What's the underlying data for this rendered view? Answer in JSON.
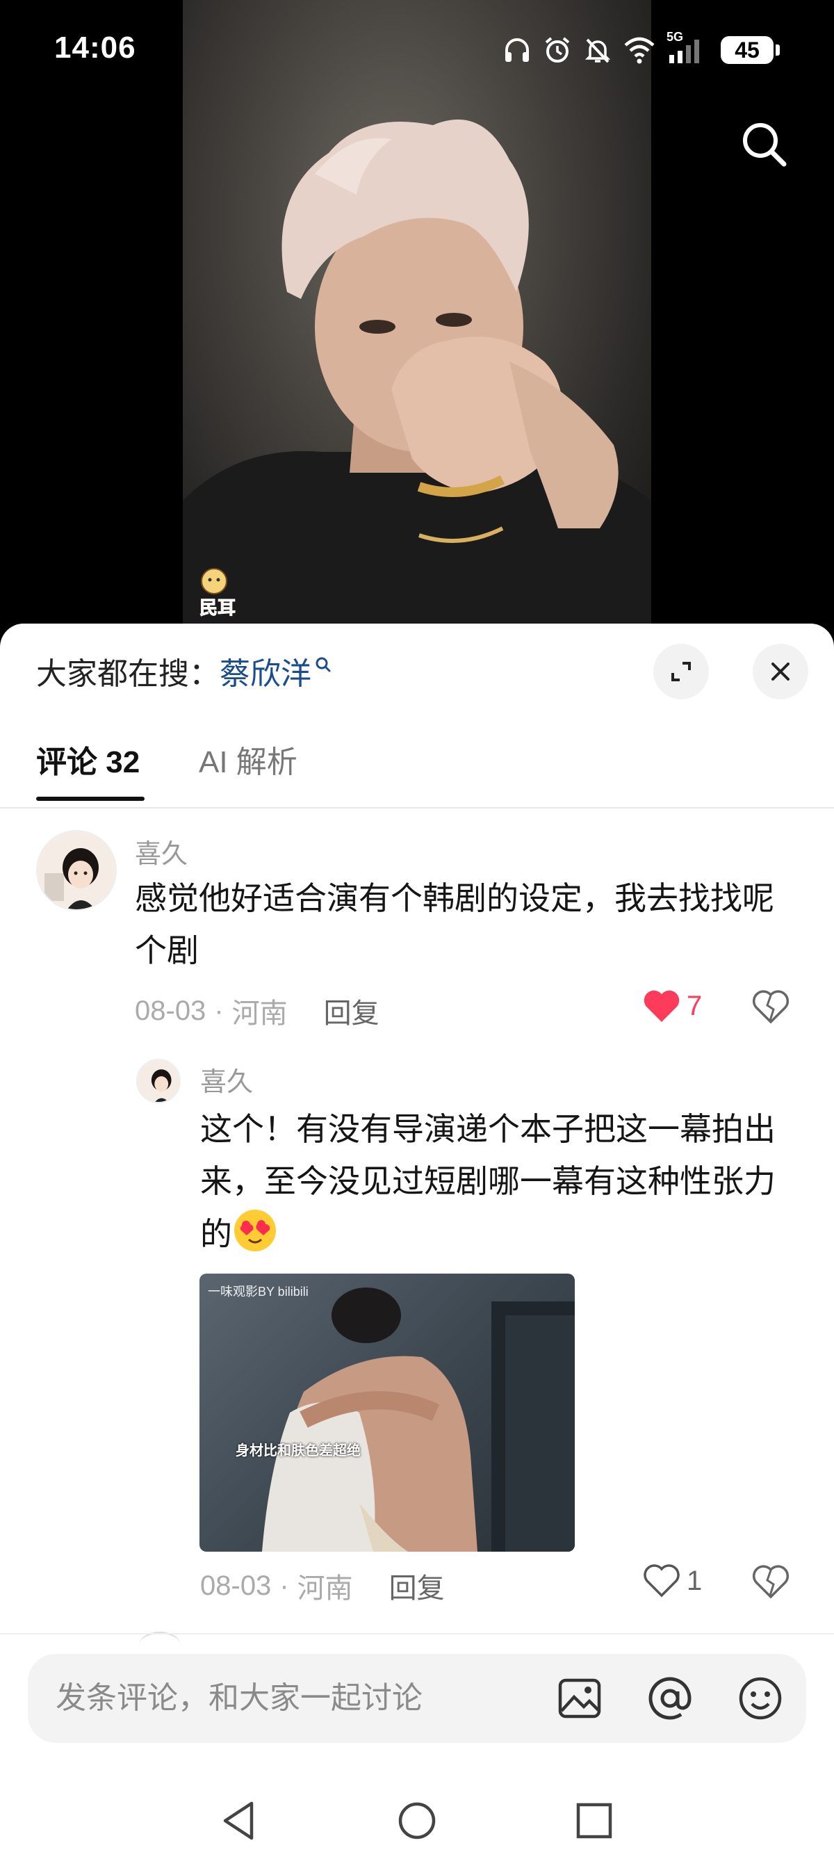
{
  "status_bar": {
    "time": "14:06",
    "network": "5G",
    "battery": "45",
    "icons": [
      "headphones-icon",
      "alarm-icon",
      "mute-icon",
      "wifi-icon",
      "signal-icon",
      "battery-icon"
    ]
  },
  "video": {
    "sticker_text": "民耳",
    "search_icon": "search-icon"
  },
  "hot_search": {
    "prefix": "大家都在搜：",
    "term": "蔡欣洋"
  },
  "tabs": [
    {
      "label": "评论 32",
      "active": true
    },
    {
      "label": "AI 解析",
      "active": false
    }
  ],
  "comments": [
    {
      "username": "喜久",
      "text": "感觉他好适合演有个韩剧的设定，我去找找呢个剧",
      "date": "08-03",
      "location": "河南",
      "reply_label": "回复",
      "likes": "7",
      "liked": true,
      "like_color": "#ff3b5c",
      "reply": {
        "username": "喜久",
        "text": "这个！有没有导演递个本子把这一幕拍出来，至今没见过短剧哪一幕有这种性张力的",
        "emoji": "heart-eyes-emoji",
        "image": {
          "watermark": "一味观影BY bilibili",
          "caption": "身材比和肤色差超绝"
        },
        "date": "08-03",
        "location": "河南",
        "reply_label": "回复",
        "likes": "1",
        "liked": false
      }
    }
  ],
  "composer": {
    "placeholder": "发条评论，和大家一起讨论",
    "icons": [
      "image-icon",
      "at-icon",
      "emoji-icon"
    ]
  },
  "nav_bar": [
    "back-icon",
    "home-icon",
    "recents-icon"
  ],
  "colors": {
    "accent_link": "#1b4d8c",
    "like_red": "#ff3b5c",
    "sheet_bg": "#ffffff"
  }
}
